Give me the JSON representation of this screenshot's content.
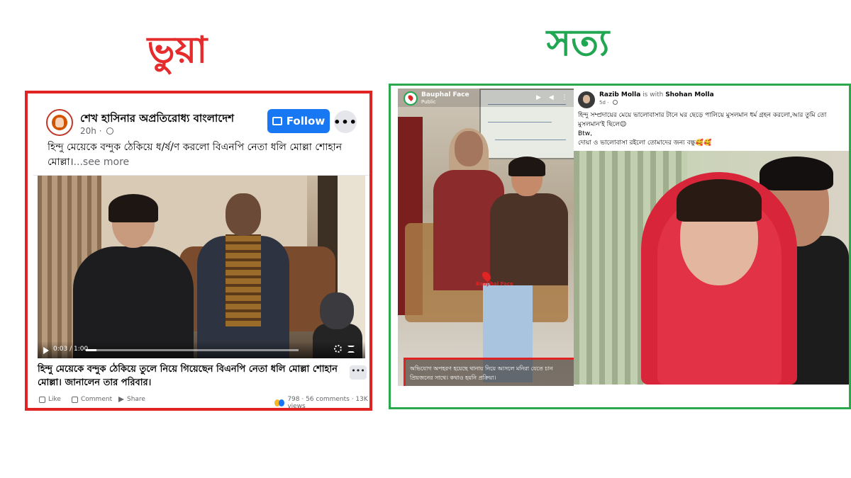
{
  "headings": {
    "fake": "ভুয়া",
    "true": "সত্য"
  },
  "colors": {
    "fake": "#e52b2b",
    "true": "#21a651",
    "fb_blue": "#1877f2"
  },
  "fake_post": {
    "page_name": "শেখ হাসিনার অপ্রতিরোধ্য বাংলাদেশ",
    "time": "20h · ",
    "follow_label": "Follow",
    "more_label": "•••",
    "text": "হিন্দু মেয়েকে বন্দুক ঠেকিয়ে ধ/র্ষ/ণ করলো বিএনপি নেতা ধলি মোল্লা শোহান মোল্লা।",
    "see_more": "...see more",
    "video": {
      "time": "0:03 / 1:00",
      "progress": 0.05
    },
    "caption": "হিন্দু মেয়েকে বন্দুক ঠেকিয়ে তুলে নিয়ে গিয়েছেন বিএনপি নেতা ধলি মোল্লা শোহান মোল্লা। জানালেন তার পরিবার।",
    "caption_more": "•••",
    "actions": {
      "like": "Like",
      "comment": "Comment",
      "share": "Share"
    },
    "stats": "798 · 56 comments · 13K views"
  },
  "true_post_a": {
    "page_name": "Bauphal Face",
    "privacy": "Public",
    "icons": "▶ ◀ ⋮",
    "pin_label": "Bauphal Face",
    "highlight_text": "অভিযোগ অপহরণ হয়েছে থানায় নিয়ে আসলে মনিরা যেতে চান প্রিয়জনের সাথে। কথাও হয়নি প্রক্রিয়া।"
  },
  "true_post_b": {
    "author": "Razib Molla",
    "with_text": "is with",
    "tagged": "Shohan Molla",
    "time": "5d · ",
    "text_line1": "হিন্দু সম্প্রদায়ের মেয়ে ভালোবাসার টানে ঘর ছেড়ে পালিয়ে মুসলমান ধর্ম গ্রহন করলো,আর তুমি তো মুসলমান'ই ছিলে😉",
    "text_line2": "Btw,",
    "text_line3": "দোয়া ও ভালোবাসা রইলো তোমাদের জন্য বন্ধু🥰🥰"
  }
}
